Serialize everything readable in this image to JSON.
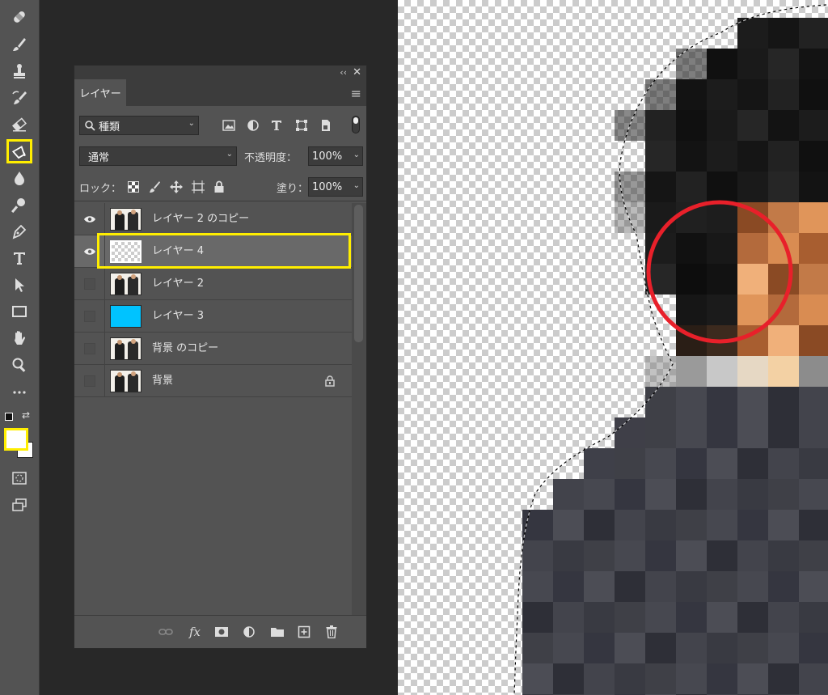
{
  "toolbar": {
    "tools": [
      "bandage-icon",
      "brush-icon",
      "stamp-icon",
      "history-brush-icon",
      "eraser-icon",
      "paint-bucket-icon",
      "blur-drop-icon",
      "dodge-icon",
      "pen-icon",
      "type-icon",
      "path-select-icon",
      "rectangle-icon",
      "hand-icon",
      "zoom-icon",
      "more-icon"
    ],
    "active_tool": "paint-bucket-icon",
    "foreground_color": "#ffffff",
    "background_color": "#ffffff"
  },
  "layers_panel": {
    "tab_label": "レイヤー",
    "filter_kind": "種類",
    "blend_mode": "通常",
    "opacity_label": "不透明度：",
    "opacity_value": "100%",
    "lock_label": "ロック：",
    "fill_label": "塗り：",
    "fill_value": "100%",
    "layers": [
      {
        "name": "レイヤー 2 のコピー",
        "visible": true,
        "thumb": "photo",
        "selected": false,
        "locked": false
      },
      {
        "name": "レイヤー 4",
        "visible": true,
        "thumb": "transparent",
        "selected": true,
        "locked": false
      },
      {
        "name": "レイヤー 2",
        "visible": false,
        "thumb": "photo",
        "selected": false,
        "locked": false
      },
      {
        "name": "レイヤー 3",
        "visible": false,
        "thumb": "cyan",
        "selected": false,
        "locked": false
      },
      {
        "name": "背景 のコピー",
        "visible": false,
        "thumb": "photo",
        "selected": false,
        "locked": false
      },
      {
        "name": "背景",
        "visible": false,
        "thumb": "photo",
        "selected": false,
        "locked": true
      }
    ],
    "bottom_icons": [
      "link-icon",
      "fx-icon",
      "mask-icon",
      "adjustment-icon",
      "group-folder-icon",
      "new-layer-icon",
      "trash-icon"
    ]
  },
  "colors": {
    "highlight": "#ffee00",
    "annotation_circle": "#e8202a",
    "layer_cyan": "#00c3ff"
  }
}
